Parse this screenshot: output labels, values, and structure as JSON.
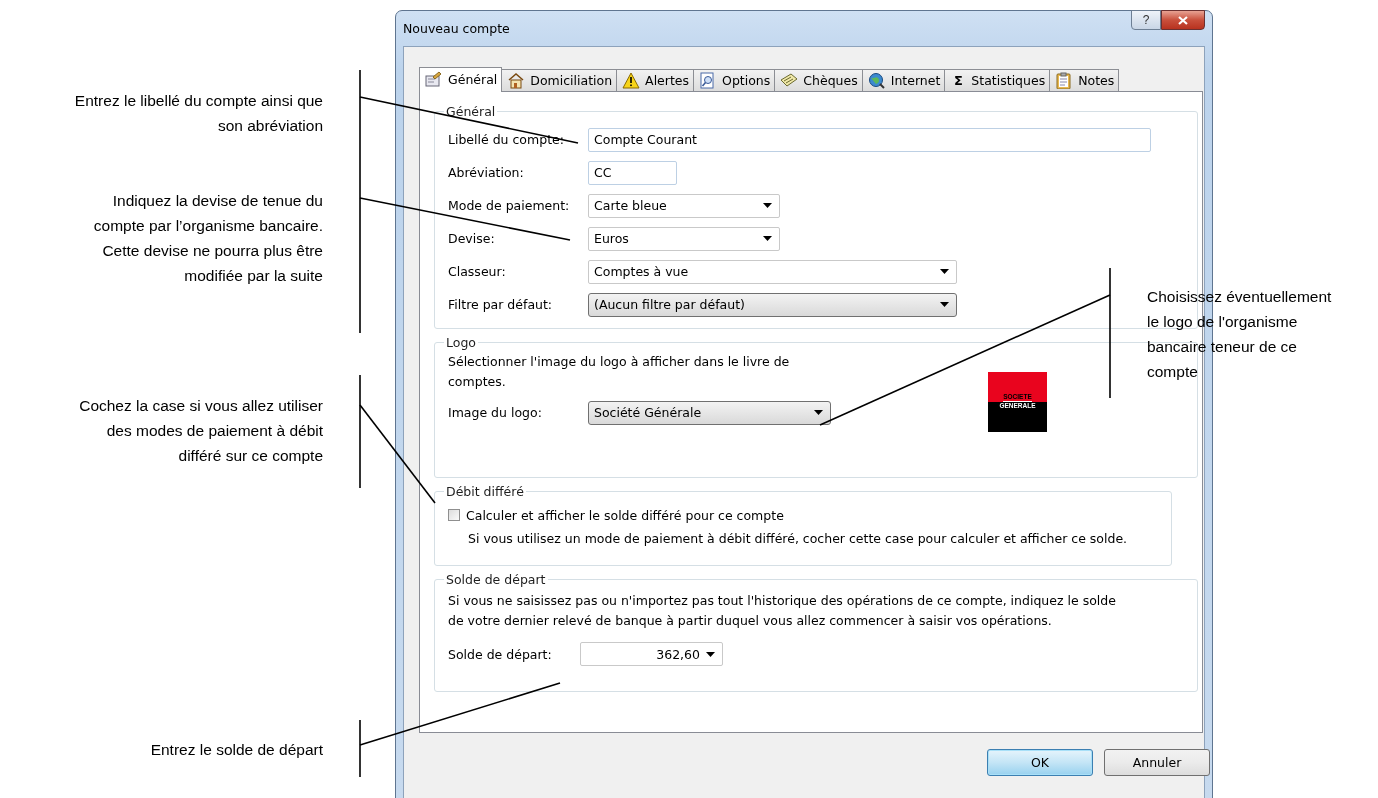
{
  "annotations_left": [
    {
      "text": "Entrez le libellé du compte ainsi que\nson abréviation"
    },
    {
      "text": "Indiquez la devise de tenue du\ncompte par l’organisme bancaire.\nCette devise ne pourra plus être\nmodifiée par la suite"
    },
    {
      "text": "Cochez la case si vous allez utiliser\ndes modes de paiement à débit\ndifféré sur ce compte"
    },
    {
      "text": "Entrez le solde de départ"
    }
  ],
  "annotation_right": {
    "text": "Choisissez éventuellement\nle logo de l'organisme\nbancaire teneur de ce\ncompte"
  },
  "window": {
    "title": "Nouveau compte",
    "help_button": "?"
  },
  "tabs": [
    {
      "label": "Général",
      "selected": true
    },
    {
      "label": "Domiciliation",
      "selected": false
    },
    {
      "label": "Alertes",
      "selected": false
    },
    {
      "label": "Options",
      "selected": false
    },
    {
      "label": "Chèques",
      "selected": false
    },
    {
      "label": "Internet",
      "selected": false
    },
    {
      "label": "Statistiques",
      "selected": false,
      "glyph": "Σ"
    },
    {
      "label": "Notes",
      "selected": false
    }
  ],
  "general": {
    "legend": "Général",
    "fields": [
      {
        "label": "Libellé du compte:",
        "kind": "input",
        "value": "Compte Courant"
      },
      {
        "label": "Abréviation:",
        "kind": "input",
        "value": "CC"
      },
      {
        "label": "Mode de paiement:",
        "kind": "combo",
        "value": "Carte bleue"
      },
      {
        "label": "Devise:",
        "kind": "combo",
        "value": "Euros"
      },
      {
        "label": "Classeur:",
        "kind": "combo",
        "value": "Comptes à vue"
      },
      {
        "label": "Filtre par défaut:",
        "kind": "dropdown",
        "value": "(Aucun filtre par défaut)"
      }
    ]
  },
  "logo": {
    "legend": "Logo",
    "description": "Sélectionner l'image du logo à afficher dans le livre de comptes.",
    "label": "Image du logo:",
    "value": "Société Générale",
    "logo_lines": [
      "SOCIETE",
      "GENERALE"
    ]
  },
  "deferred_debit": {
    "legend": "Débit différé",
    "checkbox": {
      "label": "Calculer et afficher le solde différé pour ce compte",
      "checked": false
    },
    "note": "Si vous utilisez un mode de paiement à débit différé, cocher cette case pour calculer et afficher ce solde."
  },
  "opening_balance": {
    "legend": "Solde de départ",
    "description": "Si vous ne saisissez pas ou n'importez pas tout l'historique des opérations de ce compte, indiquez le solde\nde votre dernier relevé de banque à partir duquel vous allez commencer à saisir vos opérations.",
    "label": "Solde de départ:",
    "value": "362,60"
  },
  "buttons": [
    {
      "label": "OK",
      "default": true
    },
    {
      "label": "Annuler",
      "default": false
    }
  ]
}
